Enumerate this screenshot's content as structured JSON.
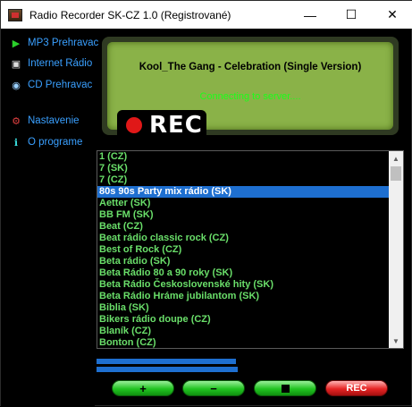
{
  "window": {
    "title": "Radio Recorder SK-CZ 1.0 (Registrované)",
    "controls": {
      "minimize": "—",
      "maximize": "☐",
      "close": "✕"
    }
  },
  "sidebar": {
    "items": [
      {
        "label": "MP3 Prehravac",
        "icon": "play-icon",
        "glyph": "▶"
      },
      {
        "label": "Internet Rádio",
        "icon": "radio-icon",
        "glyph": "▣"
      },
      {
        "label": "CD Prehravac",
        "icon": "cd-icon",
        "glyph": "◉"
      },
      {
        "label": "Nastavenie",
        "icon": "settings-icon",
        "glyph": "⚙"
      },
      {
        "label": "O programe",
        "icon": "info-icon",
        "glyph": "ℹ"
      }
    ]
  },
  "display": {
    "now_playing": "Kool_The Gang - Celebration (Single Version)",
    "status": "Connecting to server....",
    "rec_label": "REC"
  },
  "stations": [
    "1 (CZ)",
    "7 (SK)",
    "7 (CZ)",
    "80s 90s Party mix rádio (SK)",
    "Aetter (SK)",
    "BB FM (SK)",
    "Beat (CZ)",
    "Beat rádio classic rock (CZ)",
    "Best of Rock (CZ)",
    "Beta rádio (SK)",
    "Beta Rádio 80 a 90 roky (SK)",
    "Beta Rádio Československé hity (SK)",
    "Beta Rádio Hráme jubilantom (SK)",
    "Biblia (SK)",
    "Bikers rádio doupe (CZ)",
    "Blaník (CZ)",
    "Bonton (CZ)"
  ],
  "selected_station_index": 3,
  "controls": {
    "add": "+",
    "remove": "−",
    "stop": "",
    "rec": "REC"
  },
  "colors": {
    "accent_blue": "#1e6fd0",
    "station_text": "#6adf6a",
    "display_bg": "#8ab248",
    "status_text": "#1aff1a"
  }
}
